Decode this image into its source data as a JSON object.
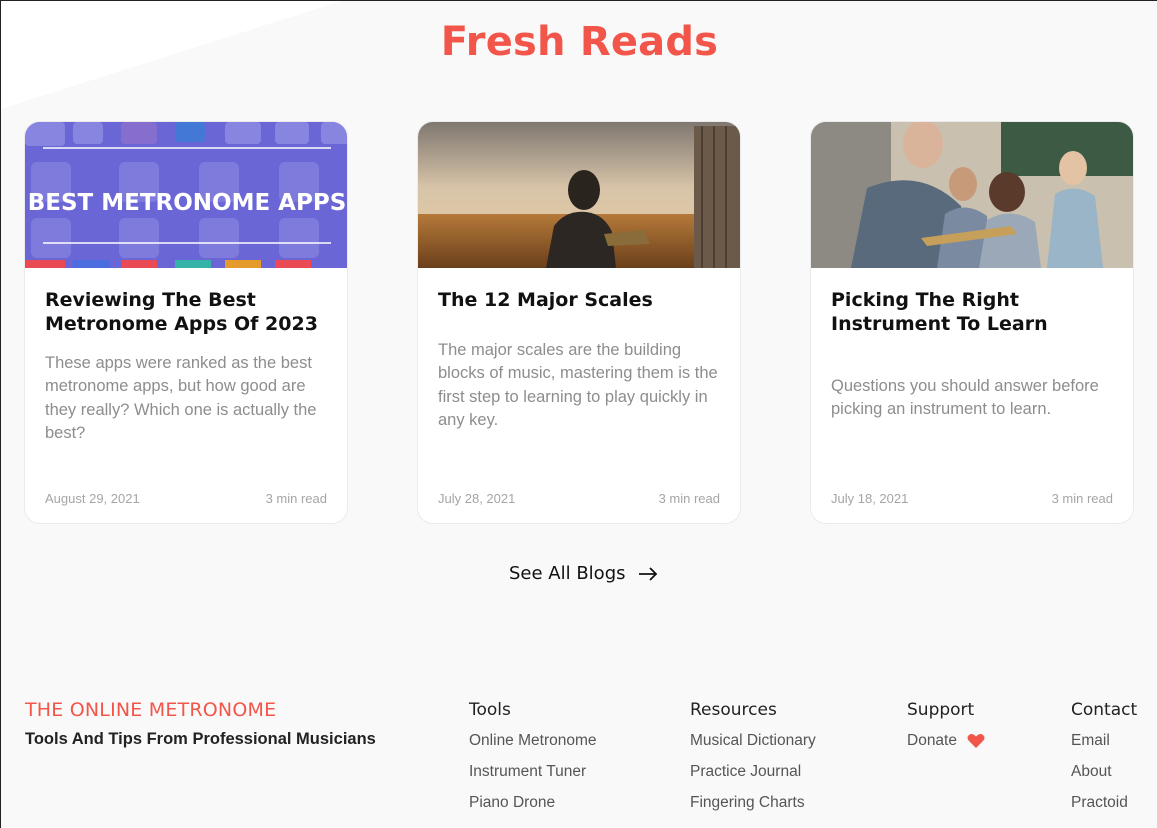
{
  "section": {
    "title": "Fresh Reads"
  },
  "cards": [
    {
      "image_text": "BEST METRONOME APPS",
      "title": "Reviewing The Best Metronome Apps Of 2023",
      "description": "These apps were ranked as the best metronome apps, but how good are they really? Which one is actually the best?",
      "date": "August 29, 2021",
      "read_time": "3 min read"
    },
    {
      "title": "The 12 Major Scales",
      "description": "The major scales are the building blocks of music, mastering them is the first step to learning to play quickly in any key.",
      "date": "July 28, 2021",
      "read_time": "3 min read"
    },
    {
      "title": "Picking The Right Instrument To Learn",
      "description": "Questions you should answer before picking an instrument to learn.",
      "date": "July 18, 2021",
      "read_time": "3 min read"
    }
  ],
  "see_all": {
    "label": "See All Blogs",
    "icon": "arrow-right-icon"
  },
  "footer": {
    "brand": "THE ONLINE METRONOME",
    "tagline": "Tools And Tips From Professional Musicians",
    "columns": [
      {
        "heading": "Tools",
        "links": [
          "Online Metronome",
          "Instrument Tuner",
          "Piano Drone"
        ]
      },
      {
        "heading": "Resources",
        "links": [
          "Musical Dictionary",
          "Practice Journal",
          "Fingering Charts"
        ]
      },
      {
        "heading": "Support",
        "links": [
          "Donate"
        ]
      },
      {
        "heading": "Contact",
        "links": [
          "Email",
          "About",
          "Practoid"
        ]
      }
    ]
  },
  "colors": {
    "accent": "#f2564a",
    "muted_text": "#8d8d8d",
    "heart": "#f2564a"
  }
}
